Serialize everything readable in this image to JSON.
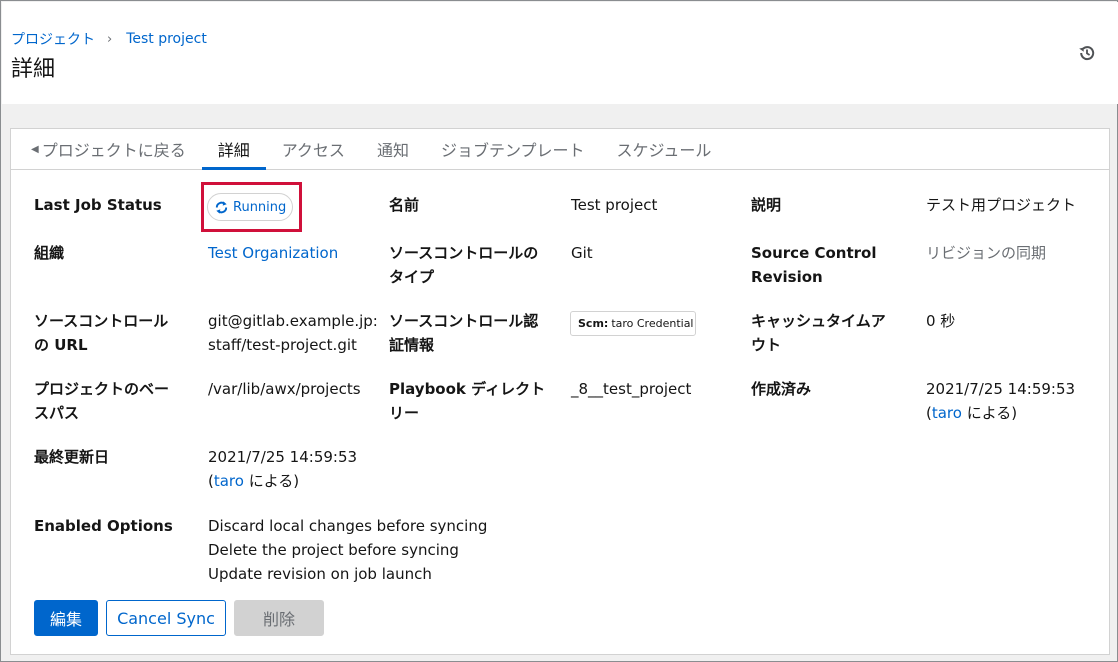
{
  "breadcrumb": {
    "root": "プロジェクト",
    "current": "Test project"
  },
  "page_title": "詳細",
  "tabs": [
    {
      "label": "プロジェクトに戻る"
    },
    {
      "label": "詳細"
    },
    {
      "label": "アクセス"
    },
    {
      "label": "通知"
    },
    {
      "label": "ジョブテンプレート"
    },
    {
      "label": "スケジュール"
    }
  ],
  "details": {
    "last_job_status": {
      "term": "Last Job Status",
      "value": "Running"
    },
    "name": {
      "term": "名前",
      "value": "Test project"
    },
    "description": {
      "term": "説明",
      "value": "テスト用プロジェクト"
    },
    "organization": {
      "term": "組織",
      "value": "Test Organization"
    },
    "scm_type": {
      "term_line1": "ソースコントロールの",
      "term_line2": "タイプ",
      "value": "Git"
    },
    "scm_revision": {
      "term_line1": "Source Control",
      "term_line2": "Revision",
      "value": "リビジョンの同期"
    },
    "scm_url": {
      "term_line1": "ソースコントロール",
      "term_line2": "の URL",
      "value_line1": "git@gitlab.example.jp:",
      "value_line2": "staff/test-project.git"
    },
    "scm_credential": {
      "term_line1": "ソースコントロール認",
      "term_line2": "証情報",
      "chip_prefix": "Scm:",
      "chip_value": "taro Credential"
    },
    "cache_timeout": {
      "term_line1": "キャッシュタイムア",
      "term_line2": "ウト",
      "value": "0 秒"
    },
    "base_path": {
      "term_line1": "プロジェクトのベー",
      "term_line2": "スパス",
      "value": "/var/lib/awx/projects"
    },
    "playbook_dir": {
      "term_line1": "Playbook ディレクト",
      "term_line2": "リー",
      "value": "_8__test_project"
    },
    "created": {
      "term": "作成済み",
      "date": "2021/7/25 14:59:53",
      "open": "(",
      "user": "taro",
      "suffix": " による)"
    },
    "modified": {
      "term": "最終更新日",
      "date": "2021/7/25 14:59:53",
      "open": "(",
      "user": "taro",
      "suffix": " による)"
    },
    "enabled_options": {
      "term": "Enabled Options",
      "items": [
        "Discard local changes before syncing",
        "Delete the project before syncing",
        "Update revision on job launch"
      ]
    }
  },
  "buttons": {
    "edit": "編集",
    "cancel_sync": "Cancel Sync",
    "delete": "削除"
  },
  "colors": {
    "accent": "#0066cc",
    "highlight": "#d0103a"
  },
  "icons": {
    "history": "history-icon",
    "running": "sync-icon",
    "back": "caret-left-icon"
  }
}
